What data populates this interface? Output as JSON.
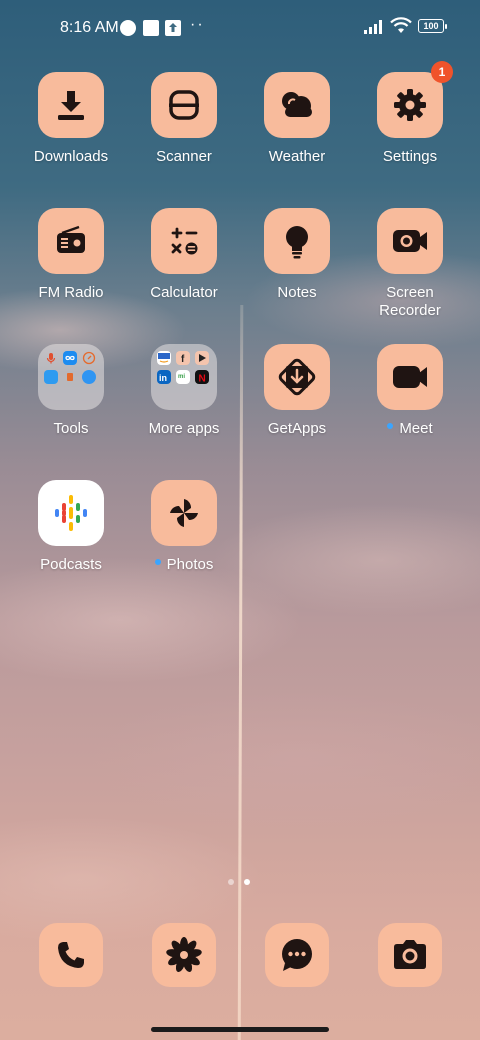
{
  "status_bar": {
    "time": "8:16 AM",
    "more": "··",
    "battery": "100"
  },
  "apps": [
    {
      "label": "Downloads"
    },
    {
      "label": "Scanner"
    },
    {
      "label": "Weather"
    },
    {
      "label": "Settings",
      "badge": "1"
    },
    {
      "label": "FM Radio"
    },
    {
      "label": "Calculator"
    },
    {
      "label": "Notes"
    },
    {
      "label": "Screen Recorder"
    },
    {
      "label": "Tools"
    },
    {
      "label": "More apps"
    },
    {
      "label": "GetApps"
    },
    {
      "label": "Meet"
    },
    {
      "label": "Podcasts"
    },
    {
      "label": "Photos"
    }
  ],
  "dock": [
    "phone-icon",
    "gallery-icon",
    "messages-icon",
    "camera-icon"
  ],
  "colors": {
    "icon_bg": "#f8bb9c",
    "icon_glyph": "#1f1412",
    "badge": "#f0532b",
    "new_dot": "#3aa5ff"
  }
}
